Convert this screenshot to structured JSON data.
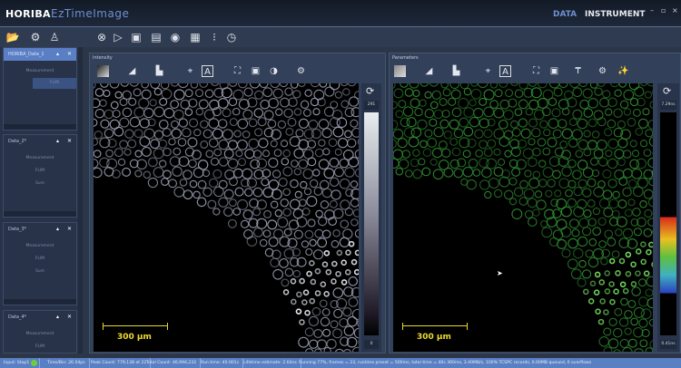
{
  "app": {
    "brand": "HORIBA",
    "product": "EzTimeImage",
    "tabs": [
      "DATA",
      "INSTRUMENT"
    ],
    "active_tab": "DATA"
  },
  "toolbar": {
    "left_icons": [
      "open-folder-icon",
      "gear-icon",
      "user-icon"
    ],
    "main_icons": [
      "stop-icon",
      "play-icon",
      "save-icon",
      "camera-icon",
      "record-icon",
      "layout-icon",
      "position-icon",
      "timer-icon"
    ]
  },
  "sidebar": {
    "panels": [
      {
        "title": "HORIBA_Data_1",
        "items": [
          "Measurement",
          "FLIM"
        ],
        "selected": true
      },
      {
        "title": "Data_2*",
        "items": [
          "Measurement",
          "FLIM",
          "Sum"
        ]
      },
      {
        "title": "Data_3*",
        "items": [
          "Measurement",
          "FLIM",
          "Sum"
        ]
      },
      {
        "title": "Data_4*",
        "items": [
          "Measurement",
          "FLIM"
        ]
      }
    ]
  },
  "intensity": {
    "title": "Intensity",
    "colorbar_max": "291",
    "colorbar_min": "0",
    "scalebar": "300 µm",
    "colormap": "grayscale"
  },
  "parameters": {
    "title": "Parameters",
    "colorbar_max": "7.29ns",
    "colorbar_min": "0.41ns",
    "scalebar": "300 µm",
    "colormap": "rainbow"
  },
  "status": {
    "input": "Input: Stop1",
    "indicator_color": "#6ccf3a",
    "time_bin": "Time/Bin: 26.04ps",
    "peak": "Peak Count: 779,138 at 22",
    "total": "Total Count: 46,994,232",
    "runtime": "Run time: 40.001s",
    "lifetime": "Lifetime estimate: 2.64ns",
    "running": "Running 77%, frames = 23, runtime preset = 500ms, total time = 40s 360ms, 3.40MB/s, 100% TCSPC records, 0.00MB queued, 0 overflows"
  }
}
